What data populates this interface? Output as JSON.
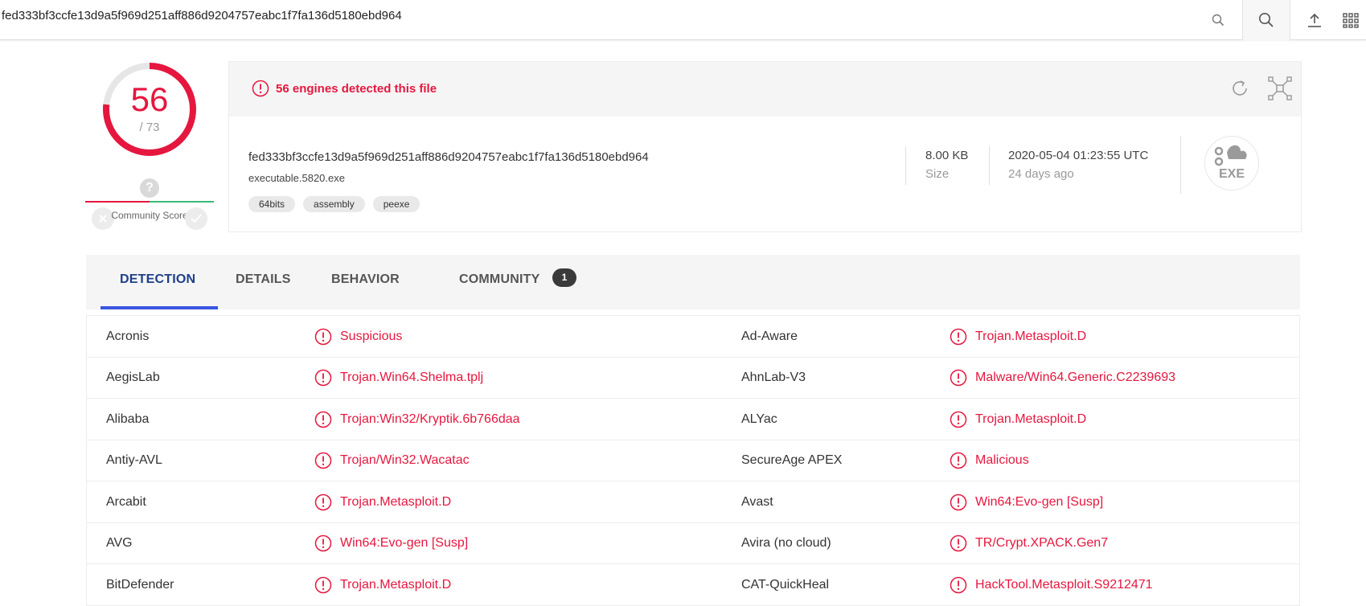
{
  "topbar": {
    "query": "fed333bf3ccfe13d9a5f969d251aff886d9204757eabc1f7fa136d5180ebd964",
    "icons": [
      "search-icon",
      "search-icon",
      "upload-icon",
      "apps-grid-icon"
    ]
  },
  "score": {
    "detections": "56",
    "total": "/ 73",
    "detected_fraction": 0.767,
    "community_label": "Community Score",
    "community_icon": "?"
  },
  "summary": {
    "alert_text": "56 engines detected this file",
    "hash": "fed333bf3ccfe13d9a5f969d251aff886d9204757eabc1f7fa136d5180ebd964",
    "filename": "executable.5820.exe",
    "tags": [
      "64bits",
      "assembly",
      "peexe"
    ],
    "size_value": "8.00 KB",
    "size_label": "Size",
    "date_value": "2020-05-04 01:23:55 UTC",
    "date_label": "24 days ago",
    "filetype": "EXE"
  },
  "tabs": {
    "detection": "DETECTION",
    "details": "DETAILS",
    "behavior": "BEHAVIOR",
    "community": "COMMUNITY",
    "community_count": "1"
  },
  "results": [
    {
      "engine_a": "Acronis",
      "verdict_a": "Suspicious",
      "engine_b": "Ad-Aware",
      "verdict_b": "Trojan.Metasploit.D"
    },
    {
      "engine_a": "AegisLab",
      "verdict_a": "Trojan.Win64.Shelma.tplj",
      "engine_b": "AhnLab-V3",
      "verdict_b": "Malware/Win64.Generic.C2239693"
    },
    {
      "engine_a": "Alibaba",
      "verdict_a": "Trojan:Win32/Kryptik.6b766daa",
      "engine_b": "ALYac",
      "verdict_b": "Trojan.Metasploit.D"
    },
    {
      "engine_a": "Antiy-AVL",
      "verdict_a": "Trojan/Win32.Wacatac",
      "engine_b": "SecureAge APEX",
      "verdict_b": "Malicious"
    },
    {
      "engine_a": "Arcabit",
      "verdict_a": "Trojan.Metasploit.D",
      "engine_b": "Avast",
      "verdict_b": "Win64:Evo-gen [Susp]"
    },
    {
      "engine_a": "AVG",
      "verdict_a": "Win64:Evo-gen [Susp]",
      "engine_b": "Avira (no cloud)",
      "verdict_b": "TR/Crypt.XPACK.Gen7"
    },
    {
      "engine_a": "BitDefender",
      "verdict_a": "Trojan.Metasploit.D",
      "engine_b": "CAT-QuickHeal",
      "verdict_b": "HackTool.Metasploit.S9212471"
    }
  ],
  "colors": {
    "malicious": "#e5173f",
    "accent": "#3a55e0",
    "community_good": "#3cb878"
  }
}
